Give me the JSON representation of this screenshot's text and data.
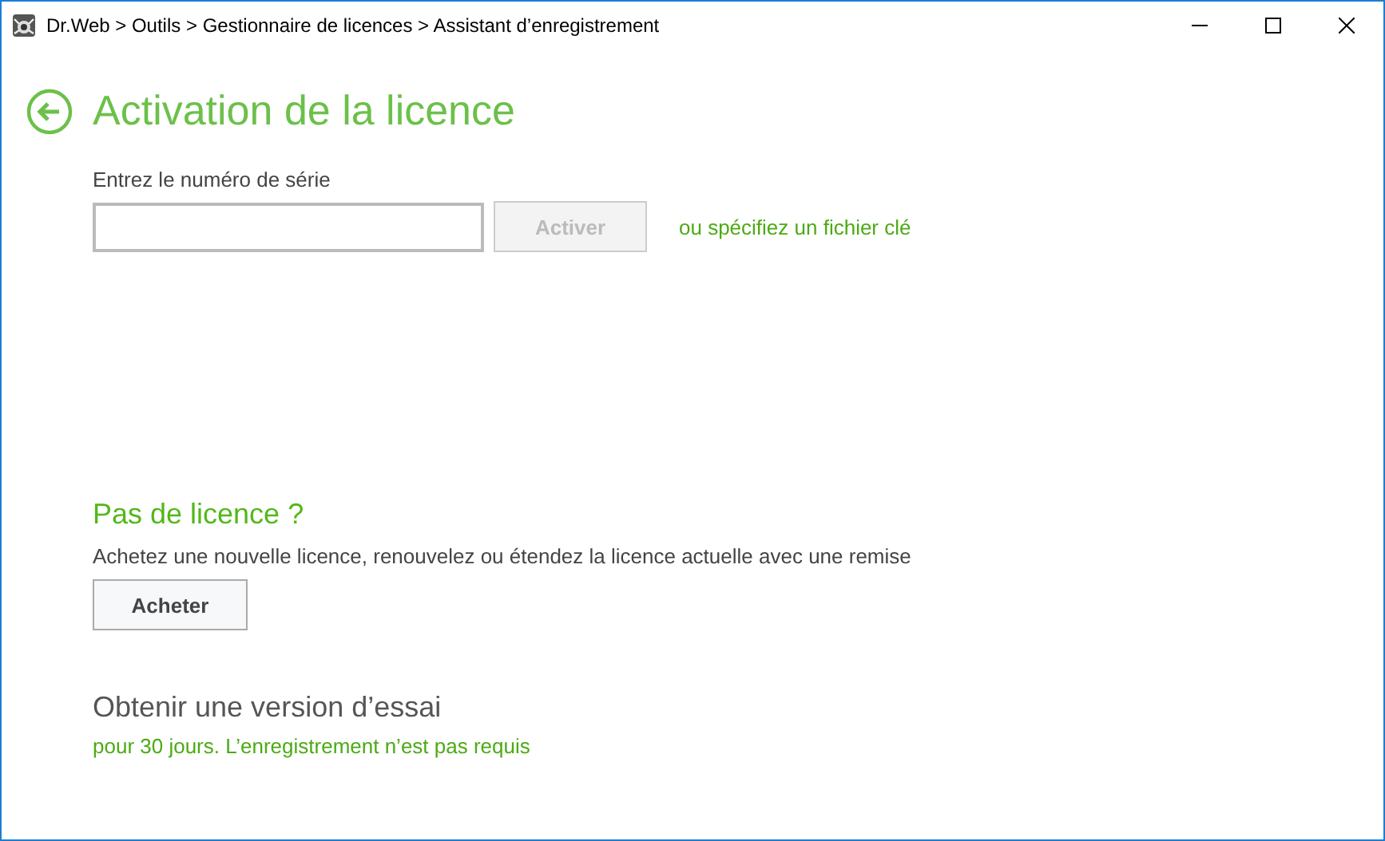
{
  "window": {
    "title": "Dr.Web > Outils > Gestionnaire de licences > Assistant d’enregistrement"
  },
  "page": {
    "title": "Activation de la licence"
  },
  "serial": {
    "label": "Entrez le numéro de série",
    "button": {
      "label": "Activer",
      "disabled": true
    },
    "key_file_link": "ou spécifiez un fichier clé"
  },
  "no_license": {
    "title": "Pas de licence ?",
    "description": "Achetez une nouvelle licence, renouvelez ou étendez la licence actuelle avec une remise",
    "button": "Acheter"
  },
  "trial": {
    "title": "Obtenir une version d’essai",
    "link": "pour 30 jours. L’enregistrement n’est pas requis"
  }
}
